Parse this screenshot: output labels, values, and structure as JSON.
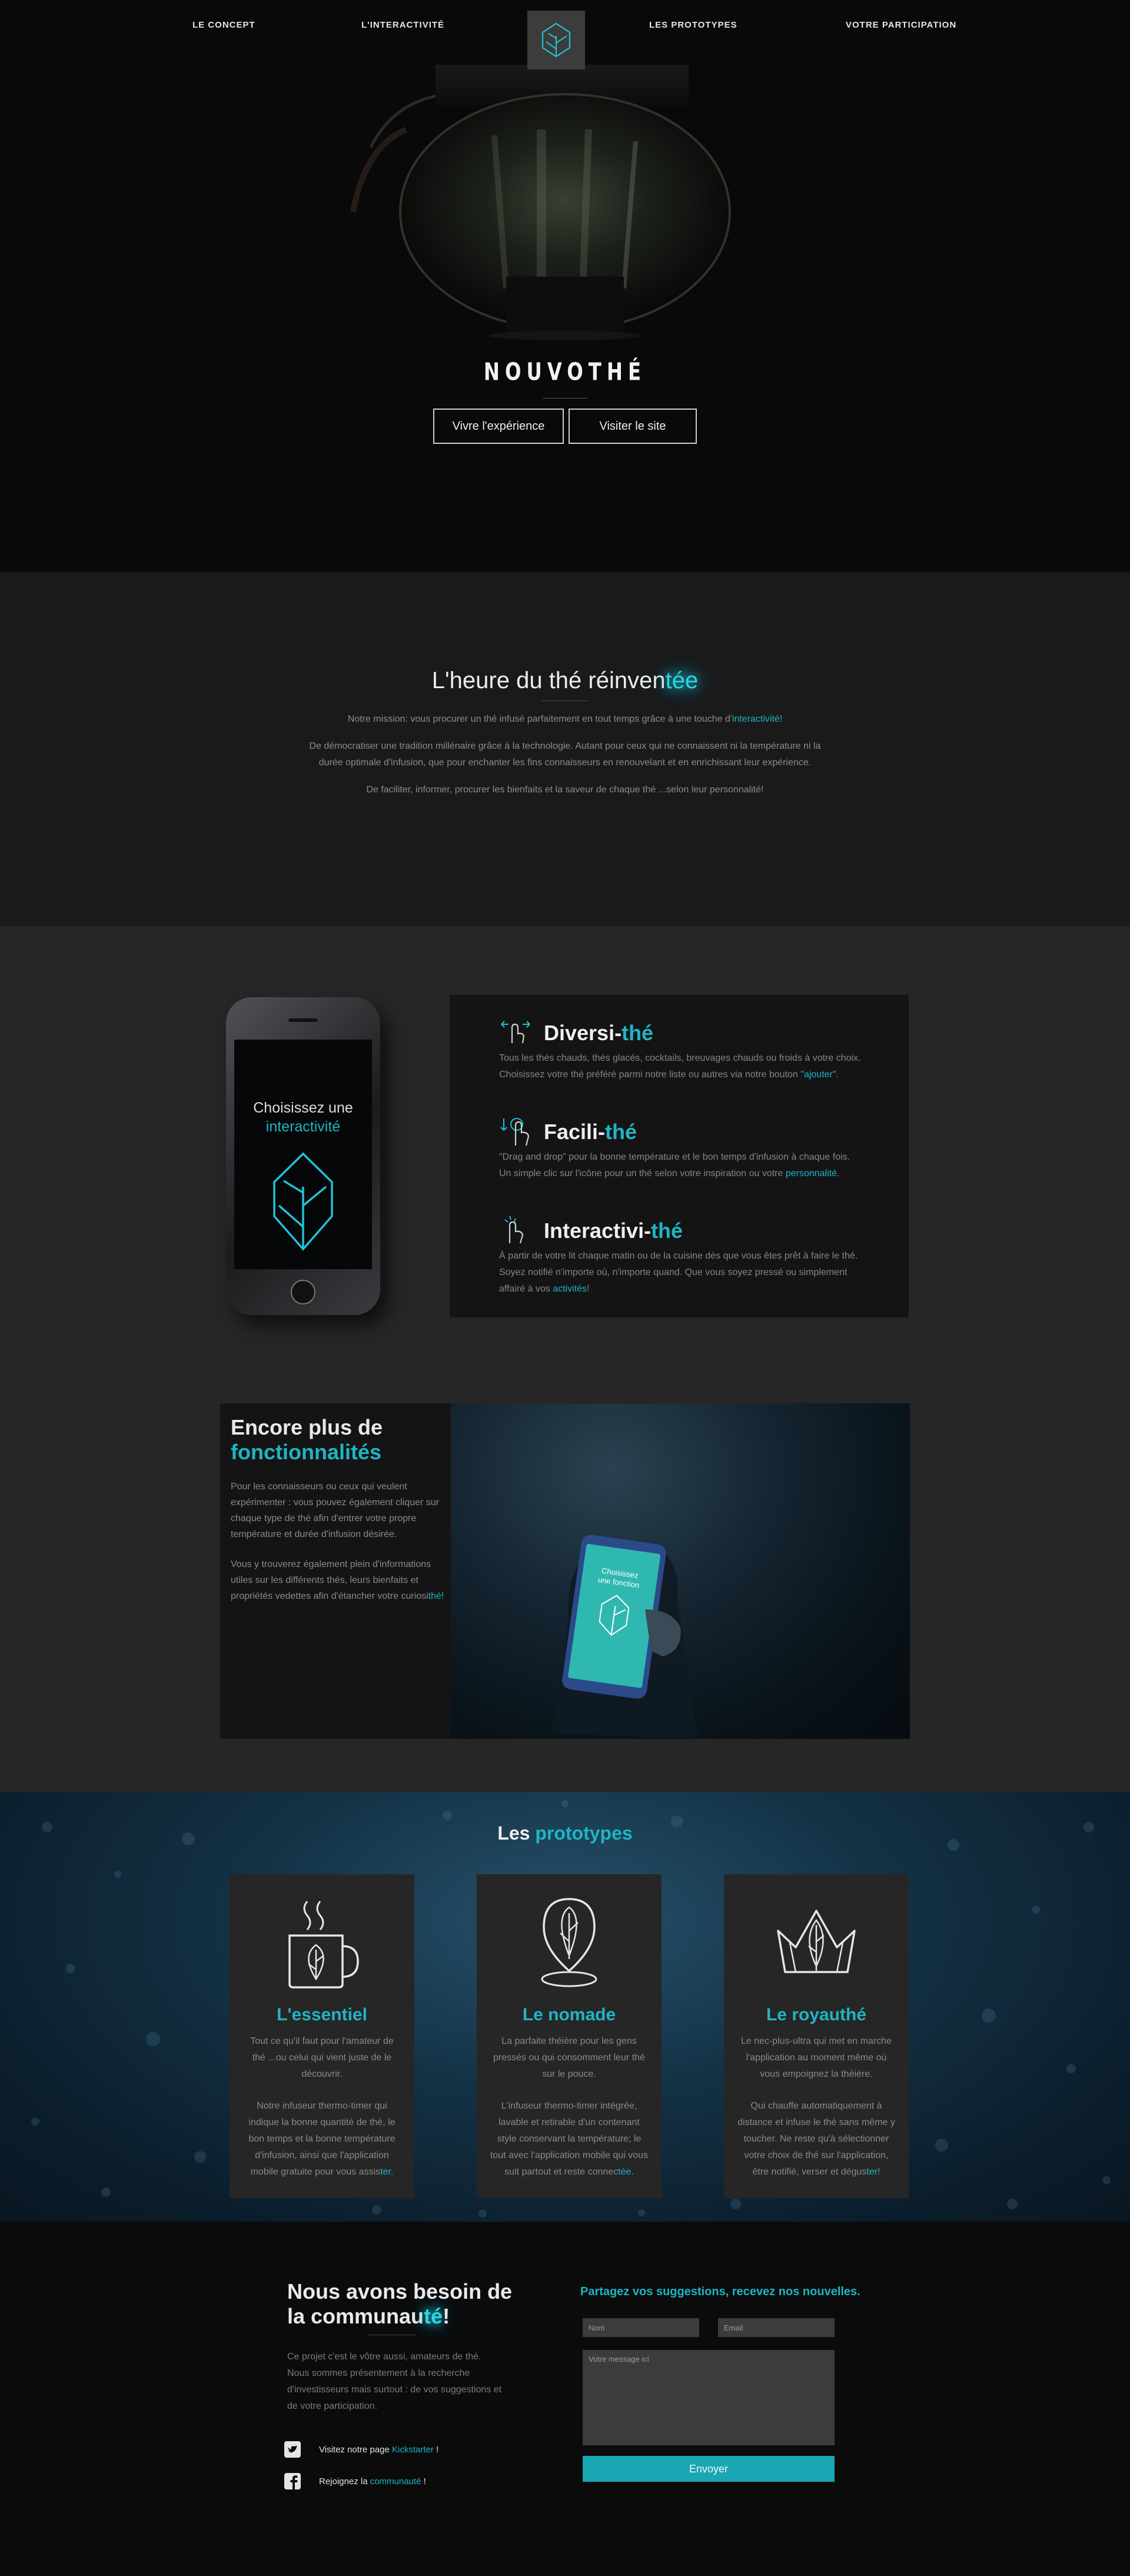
{
  "nav": {
    "left": [
      "LE CONCEPT",
      "L'INTERACTIVITÉ"
    ],
    "right": [
      "LES PROTOTYPES",
      "VOTRE PARTICIPATION"
    ],
    "logo_icon": "leaf-icon"
  },
  "hero": {
    "brand": "NOUVOTHÉ",
    "btn_experience": "Vivre l'expérience",
    "btn_site": "Visiter le site"
  },
  "mission": {
    "title_main": "L'heure du thé réinven",
    "title_accent": "tée",
    "p1_text": "Notre mission: vous procurer un thé infusé parfaitement en tout temps grâce à une touche d'",
    "p1_accent": "interactivité!",
    "p2_line1": "De démocratiser une tradition millénaire grâce à la technologie. Autant pour ceux qui ne connaissent ni la température ni la",
    "p2_line2": "durée optimale d'infusion, que pour enchanter les fins connaisseurs en renouvelant et en enrichissant leur expérience.",
    "p3": "De faciliter, informer, procurer les bienfaits et la saveur de chaque thé ...selon leur personnalité!"
  },
  "phone": {
    "line1": "Choisissez une",
    "line2": "interactivité"
  },
  "features": [
    {
      "title": "Diversi-",
      "title_accent": "thé",
      "icon": "swipe-hand-icon",
      "text": "Tous les thés chauds, thés glacés, cocktails, breuvages chauds ou froids à votre choix. Choisissez votre thé préféré parmi notre liste ou autres via notre bouton ",
      "text_accent": "\"ajouter\"",
      "text_end": "."
    },
    {
      "title": "Facili-",
      "title_accent": "thé",
      "icon": "drag-drop-icon",
      "text": "\"Drag and drop\" pour la bonne température et le bon temps d'infusion à chaque fois. Un simple clic sur l'icône pour un thé selon votre inspiration ou votre ",
      "text_accent": "personnalité",
      "text_end": "."
    },
    {
      "title": "Interactivi-",
      "title_accent": "thé",
      "icon": "tap-hand-icon",
      "text": "À partir de votre lit chaque matin ou de la cuisine dès que vous êtes prêt à faire le thé. Soyez notifié n'importe où, n'importe quand. Que vous soyez pressé ou simplement affairé à vos ",
      "text_accent": "activités",
      "text_end": "!"
    }
  ],
  "more": {
    "title_line1": "Encore plus de",
    "title_line2": "fonctionnalités",
    "p1": "Pour les connaisseurs ou ceux qui veulent expérimenter : vous pouvez également cliquer sur chaque type de thé afin d'entrer votre propre température et durée d'infusion désirée.",
    "p2": "Vous y trouverez également plein d'informations utiles sur les différents thés, leurs bienfaits et propriétés vedettes afin d'étancher votre curiosi",
    "p2_accent": "thé!",
    "photo_screen_text": "Choisissez une fonction"
  },
  "protos": {
    "title": "Les ",
    "title_accent": "prototypes",
    "cards": [
      {
        "title": "L'essentiel",
        "icon": "tea-mug-icon",
        "p1": "Tout ce qu'il faut pour l'amateur de thé ...ou celui qui vient juste de le découvrir.",
        "p2": "Notre infuseur thermo-timer qui indique la bonne quantité de thé, le bon temps et la bonne température d'infusion, ainsi que l'application mobile gratuite pour vous assis",
        "p2_accent": "ter."
      },
      {
        "title": "Le nomade",
        "icon": "leaf-pin-icon",
        "p1": "La parfaite théière pour les gens pressés ou qui consomment leur thé sur le pouce.",
        "p2": "L'infuseur thermo-timer intégrée, lavable et retirable d'un contenant style conservant la température; le tout avec l'application mobile qui vous suit partout et reste connec",
        "p2_accent": "tée."
      },
      {
        "title": "Le royauthé",
        "icon": "crown-icon",
        "p1": "Le nec-plus-ultra qui met en marche l'application au moment même où vous empoignez la théière.",
        "p2": "Qui chauffe automatiquement à distance et infuse le thé sans même y toucher. Ne reste qu'à sélectionner votre choix de thé sur l'application, être notifié, verser et dégus",
        "p2_accent": "ter!"
      }
    ]
  },
  "contact": {
    "title_line1": "Nous avons besoin de",
    "title_line2_main": "la communau",
    "title_line2_accent": "té",
    "title_line2_end": "!",
    "text": "Ce projet c'est le vôtre aussi, amateurs de thé. Nous sommes présentement à la recherche d'investisseurs mais surtout : de vos suggestions et de votre participation.",
    "kickstarter_pre": "Visitez notre page ",
    "kickstarter_link": "Kickstarter",
    "kickstarter_post": " !",
    "community_pre": "Rejoignez la ",
    "community_link": "communauté",
    "community_post": " !",
    "form_headline": "Partagez vos suggestions, recevez nos nouvelles.",
    "name_placeholder": "Nom",
    "email_placeholder": "Email",
    "message_placeholder": "Votre message ici",
    "send_label": "Envoyer"
  },
  "colors": {
    "accent": "#1fb5c4",
    "hero_bg": "#09090a",
    "section_dark": "#1a1a1b",
    "section_mid": "#262627",
    "card_bg": "#141415"
  }
}
